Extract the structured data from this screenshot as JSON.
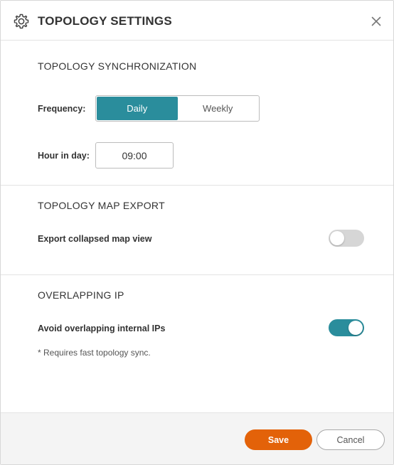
{
  "dialog": {
    "title": "TOPOLOGY SETTINGS",
    "header_icon": "gear-icon",
    "close_icon": "close-icon"
  },
  "sync": {
    "section_title": "TOPOLOGY SYNCHRONIZATION",
    "frequency_label": "Frequency:",
    "frequency_options": [
      "Daily",
      "Weekly"
    ],
    "frequency_selected": "Daily",
    "hour_label": "Hour in day:",
    "hour_value": "09:00"
  },
  "export": {
    "section_title": "TOPOLOGY MAP EXPORT",
    "collapsed_label": "Export collapsed map view",
    "collapsed_enabled": false
  },
  "overlap": {
    "section_title": "OVERLAPPING IP",
    "avoid_label": "Avoid overlapping internal IPs",
    "avoid_enabled": true,
    "note": "* Requires fast topology sync."
  },
  "footer": {
    "save_label": "Save",
    "cancel_label": "Cancel"
  },
  "colors": {
    "accent": "#2a8d9c",
    "primary_button": "#e36209",
    "toggle_off": "#d6d6d6"
  }
}
